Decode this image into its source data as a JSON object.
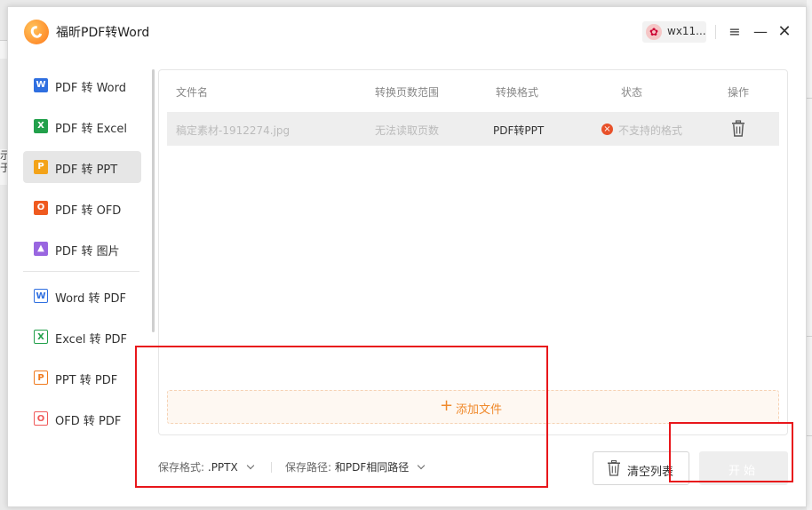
{
  "app": {
    "title": "福昕PDF转Word",
    "user_name": "wx11..."
  },
  "window_controls": {
    "menu": "≡",
    "minimize": "—",
    "close": "✕"
  },
  "background": {
    "peek_chars": [
      "示",
      "于"
    ]
  },
  "sidebar": {
    "items": [
      {
        "label": "PDF 转 Word",
        "icon": "word-icon",
        "glyph": "W",
        "active": false
      },
      {
        "label": "PDF 转 Excel",
        "icon": "excel-icon",
        "glyph": "X",
        "active": false
      },
      {
        "label": "PDF 转 PPT",
        "icon": "ppt-icon",
        "glyph": "P",
        "active": true
      },
      {
        "label": "PDF 转 OFD",
        "icon": "ofd-icon",
        "glyph": "O",
        "active": false
      },
      {
        "label": "PDF 转 图片",
        "icon": "image-icon",
        "glyph": "▲",
        "active": false
      },
      {
        "label": "Word 转 PDF",
        "icon": "word-to-pdf-icon",
        "glyph": "W",
        "active": false
      },
      {
        "label": "Excel 转 PDF",
        "icon": "excel-to-pdf-icon",
        "glyph": "X",
        "active": false
      },
      {
        "label": "PPT 转 PDF",
        "icon": "ppt-to-pdf-icon",
        "glyph": "P",
        "active": false
      },
      {
        "label": "OFD 转 PDF",
        "icon": "ofd-to-pdf-icon",
        "glyph": "O",
        "active": false
      }
    ]
  },
  "table": {
    "headers": {
      "filename": "文件名",
      "page_range": "转换页数范围",
      "format": "转换格式",
      "status": "状态",
      "action": "操作"
    },
    "rows": [
      {
        "filename": "稿定素材-1912274.jpg",
        "page_range": "无法读取页数",
        "format": "PDF转PPT",
        "status": "不支持的格式"
      }
    ]
  },
  "add_file": {
    "plus": "+",
    "label": "添加文件"
  },
  "footer": {
    "save_format_label": "保存格式:",
    "save_format_value": ".PPTX",
    "save_path_label": "保存路径:",
    "save_path_value": "和PDF相同路径",
    "clear_list_label": "清空列表",
    "start_label": "开始"
  },
  "colors": {
    "accent": "#f08a2c",
    "error": "#e8512a",
    "annotation": "#e8161b"
  }
}
